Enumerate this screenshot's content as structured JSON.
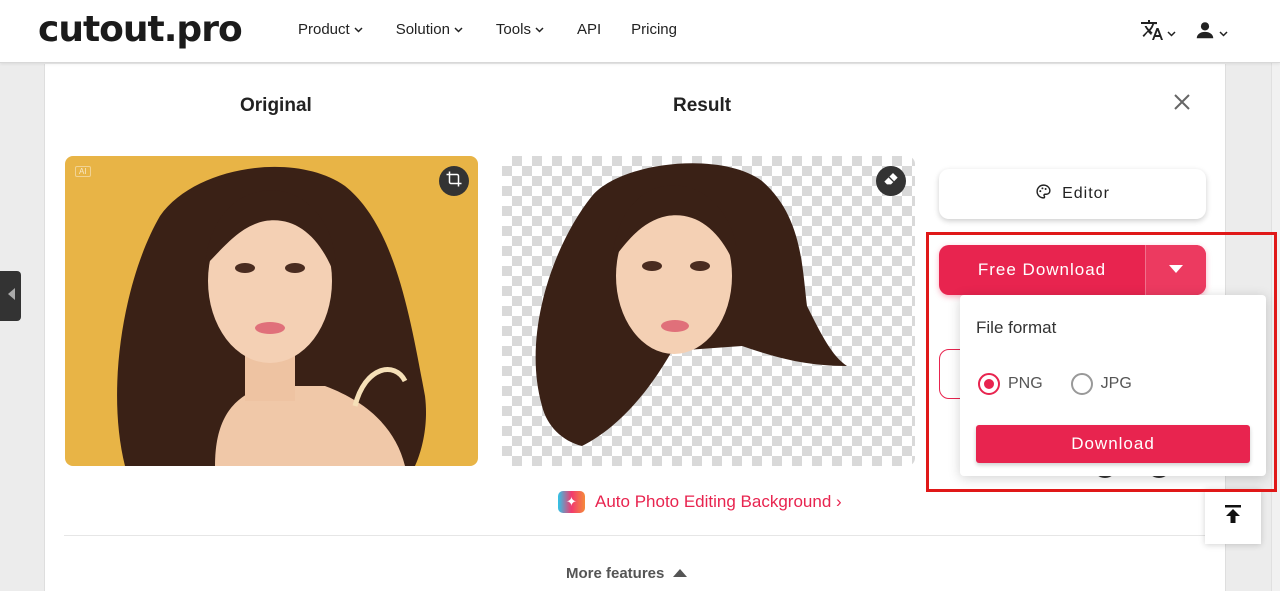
{
  "header": {
    "logo": "cutout.pro",
    "nav": [
      {
        "label": "Product",
        "has_menu": true
      },
      {
        "label": "Solution",
        "has_menu": true
      },
      {
        "label": "Tools",
        "has_menu": true
      },
      {
        "label": "API",
        "has_menu": false
      },
      {
        "label": "Pricing",
        "has_menu": false
      }
    ],
    "language_icon": "translate-icon",
    "account_icon": "user-icon"
  },
  "panel": {
    "original_title": "Original",
    "result_title": "Result",
    "ai_badge": "AI",
    "editor_label": "Editor",
    "free_download_label": "Free Download",
    "auto_link_label": "Auto Photo Editing Background ›",
    "more_features_label": "More features"
  },
  "dropdown": {
    "title": "File format",
    "options": [
      {
        "label": "PNG",
        "selected": true
      },
      {
        "label": "JPG",
        "selected": false
      }
    ],
    "download_label": "Download"
  },
  "colors": {
    "accent": "#e8244f",
    "highlight_frame": "#e01818",
    "original_bg": "#e8b446"
  }
}
